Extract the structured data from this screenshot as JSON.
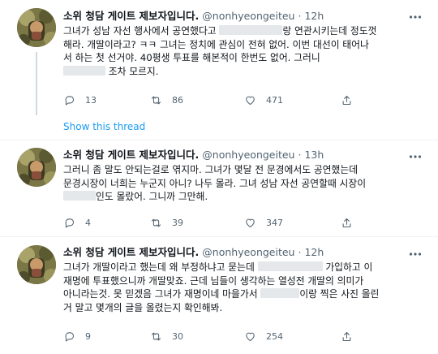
{
  "tweets": [
    {
      "name": "소위 청담 게이트 제보자입니다.",
      "handle": "@nonhyeongeiteu",
      "dot": "·",
      "time": "12h",
      "lines": [
        [
          "그녀가 성남 자선 행사에서 공연했다고 ",
          "[redacted]",
          "랑 연관시키는데 정도껏"
        ],
        [
          "해라. 개딸이라고? ㅋㅋ 그녀는 정치에 관심이 전혀 없어. 이번 대선이 태어나"
        ],
        [
          "서 하는 첫 선거야. 40평생 투표를 해본적이 한번도 없어. 그러니 "
        ],
        [
          "[redacted]",
          " 조차 모르지."
        ]
      ],
      "replies": "13",
      "retweets": "86",
      "likes": "471"
    },
    {
      "name": "소위 청담 게이트 제보자입니다.",
      "handle": "@nonhyeongeiteu",
      "dot": "·",
      "time": "13h",
      "lines": [
        [
          "그러니 좀 말도 안되는걸로 엮지마. 그녀가 몇달 전 문경에서도 공연했는데"
        ],
        [
          "문경시장이 너희는 누군지 아니? 나두 몰라. 그녀 성남 자선 공연할때 시장이"
        ],
        [
          "[redacted]",
          "인도 몰랐어. 그니까 그만해."
        ]
      ],
      "replies": "4",
      "retweets": "39",
      "likes": "347"
    },
    {
      "name": "소위 청담 게이트 제보자입니다.",
      "handle": "@nonhyeongeiteu",
      "dot": "·",
      "time": "12h",
      "lines": [
        [
          "그녀가 개딸이라고 했는데 왜 부정하냐고 묻는데 ",
          "[redacted]",
          " 가입하고 이"
        ],
        [
          "재명에 투표했으니까 개딸맞죠. 근데 님들이 생각하는 열성전 개딸의 의미가"
        ],
        [
          "아니라는것. 못 믿겠음 그녀가 재명이네 마을가서 ",
          "[redacted]",
          "이랑 찍은 사진 올린"
        ],
        [
          "거 말고 몇개의 글을 올렸는지 확인해봐."
        ]
      ],
      "replies": "9",
      "retweets": "30",
      "likes": "254"
    }
  ],
  "show_thread": "Show this thread",
  "icons": {
    "reply": "reply-icon",
    "retweet": "retweet-icon",
    "like": "heart-icon",
    "share": "share-icon",
    "more": "more-icon"
  },
  "colors": {
    "text": "#0f1419",
    "secondary": "#536471",
    "link": "#1d9bf0",
    "redaction": "#e4e8ea",
    "divider": "#eff3f4"
  }
}
